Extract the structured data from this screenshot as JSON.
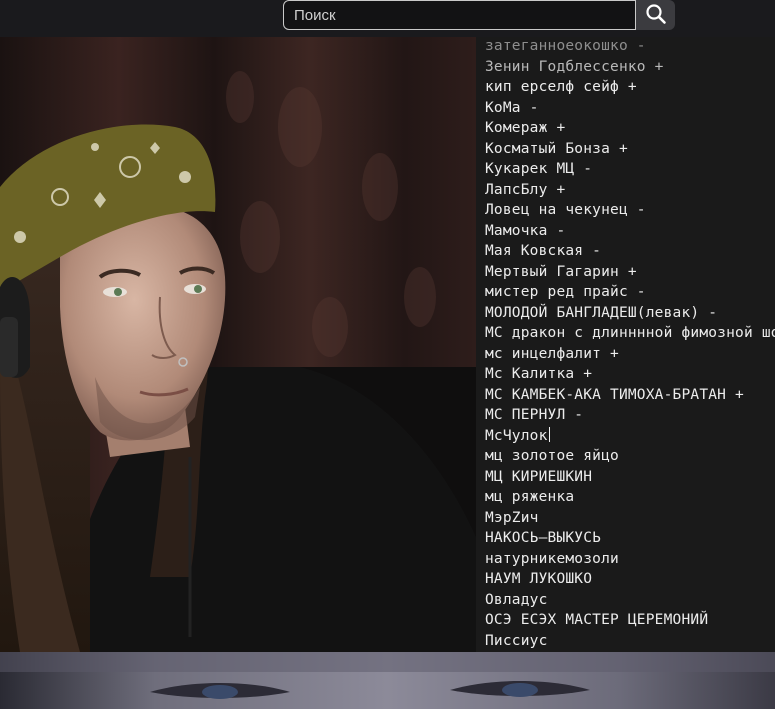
{
  "search": {
    "placeholder": "Поиск",
    "value": ""
  },
  "name_list": [
    "затеганноеокошко -",
    "Зенин Годблессенко +",
    "кип ерселф сейф +",
    "КоМа -",
    "Комераж +",
    "Косматый Бонза +",
    "Кукарек МЦ -",
    "ЛапсБлу +",
    "Ловец на чекунец -",
    "Мамочка -",
    "Мая Ковская -",
    "Мертвый Гагарин +",
    "мистер ред прайс -",
    "МОЛОДОЙ БАНГЛАДЕШ(левак) -",
    "МС дракон с длинннной фимозной шо",
    "мс инцелфалит +",
    "Мс Калитка +",
    "МС КАМБЕК-АКА ТИМОХА-БРАТАН +",
    "МС ПЕРНУЛ -",
    "МсЧулок",
    "мц золотое яйцо",
    "МЦ КИРИЕШКИН",
    "мц ряженка",
    "МэрZич",
    "НАКОСЬ—ВЫКУСЬ",
    "натурникемозоли",
    "НАУМ ЛУКОШКО",
    "Овладус",
    "ОСЭ ЕСЭХ МАСТЕР ЦЕРЕМОНИЙ",
    "Писсиус"
  ]
}
